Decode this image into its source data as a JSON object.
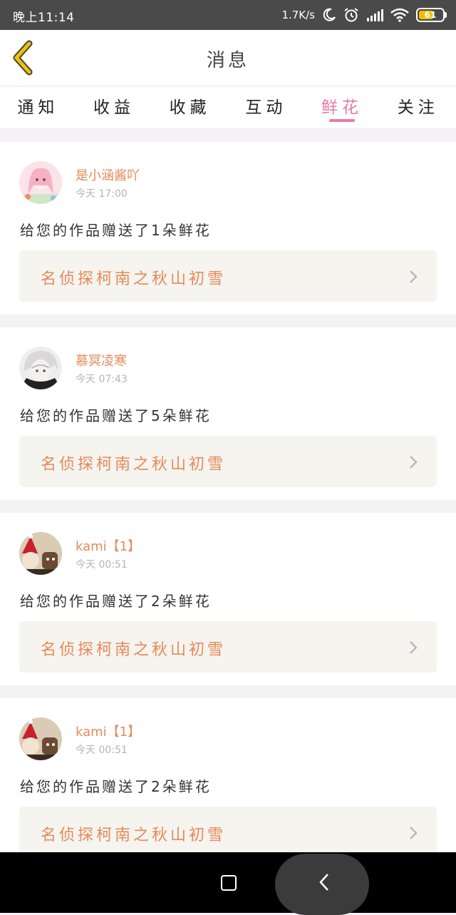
{
  "status_bar": {
    "time": "晚上11:14",
    "net_speed": "1.7K/s",
    "battery_level": "61",
    "battery_fraction": 0.61
  },
  "header": {
    "title": "消息",
    "back_icon": "chevron-left-icon"
  },
  "tabs": [
    {
      "label": "通知",
      "active": false
    },
    {
      "label": "收益",
      "active": false
    },
    {
      "label": "收藏",
      "active": false
    },
    {
      "label": "互动",
      "active": false
    },
    {
      "label": "鲜花",
      "active": true
    },
    {
      "label": "关注",
      "active": false
    }
  ],
  "notifications": [
    {
      "user": "是小涵酱吖",
      "time": "今天 17:00",
      "message": "给您的作品赠送了1朵鲜花",
      "work": "名侦探柯南之秋山初雪"
    },
    {
      "user": "慕冥凌寒",
      "time": "今天 07:43",
      "message": "给您的作品赠送了5朵鲜花",
      "work": "名侦探柯南之秋山初雪"
    },
    {
      "user": "kami【1】",
      "time": "今天 00:51",
      "message": "给您的作品赠送了2朵鲜花",
      "work": "名侦探柯南之秋山初雪"
    },
    {
      "user": "kami【1】",
      "time": "今天 00:51",
      "message": "给您的作品赠送了2朵鲜花",
      "work": "名侦探柯南之秋山初雪"
    }
  ],
  "colors": {
    "accent_pink": "#e87aa4",
    "orange_text": "#e58a5b",
    "back_arrow": "#f0c200"
  }
}
